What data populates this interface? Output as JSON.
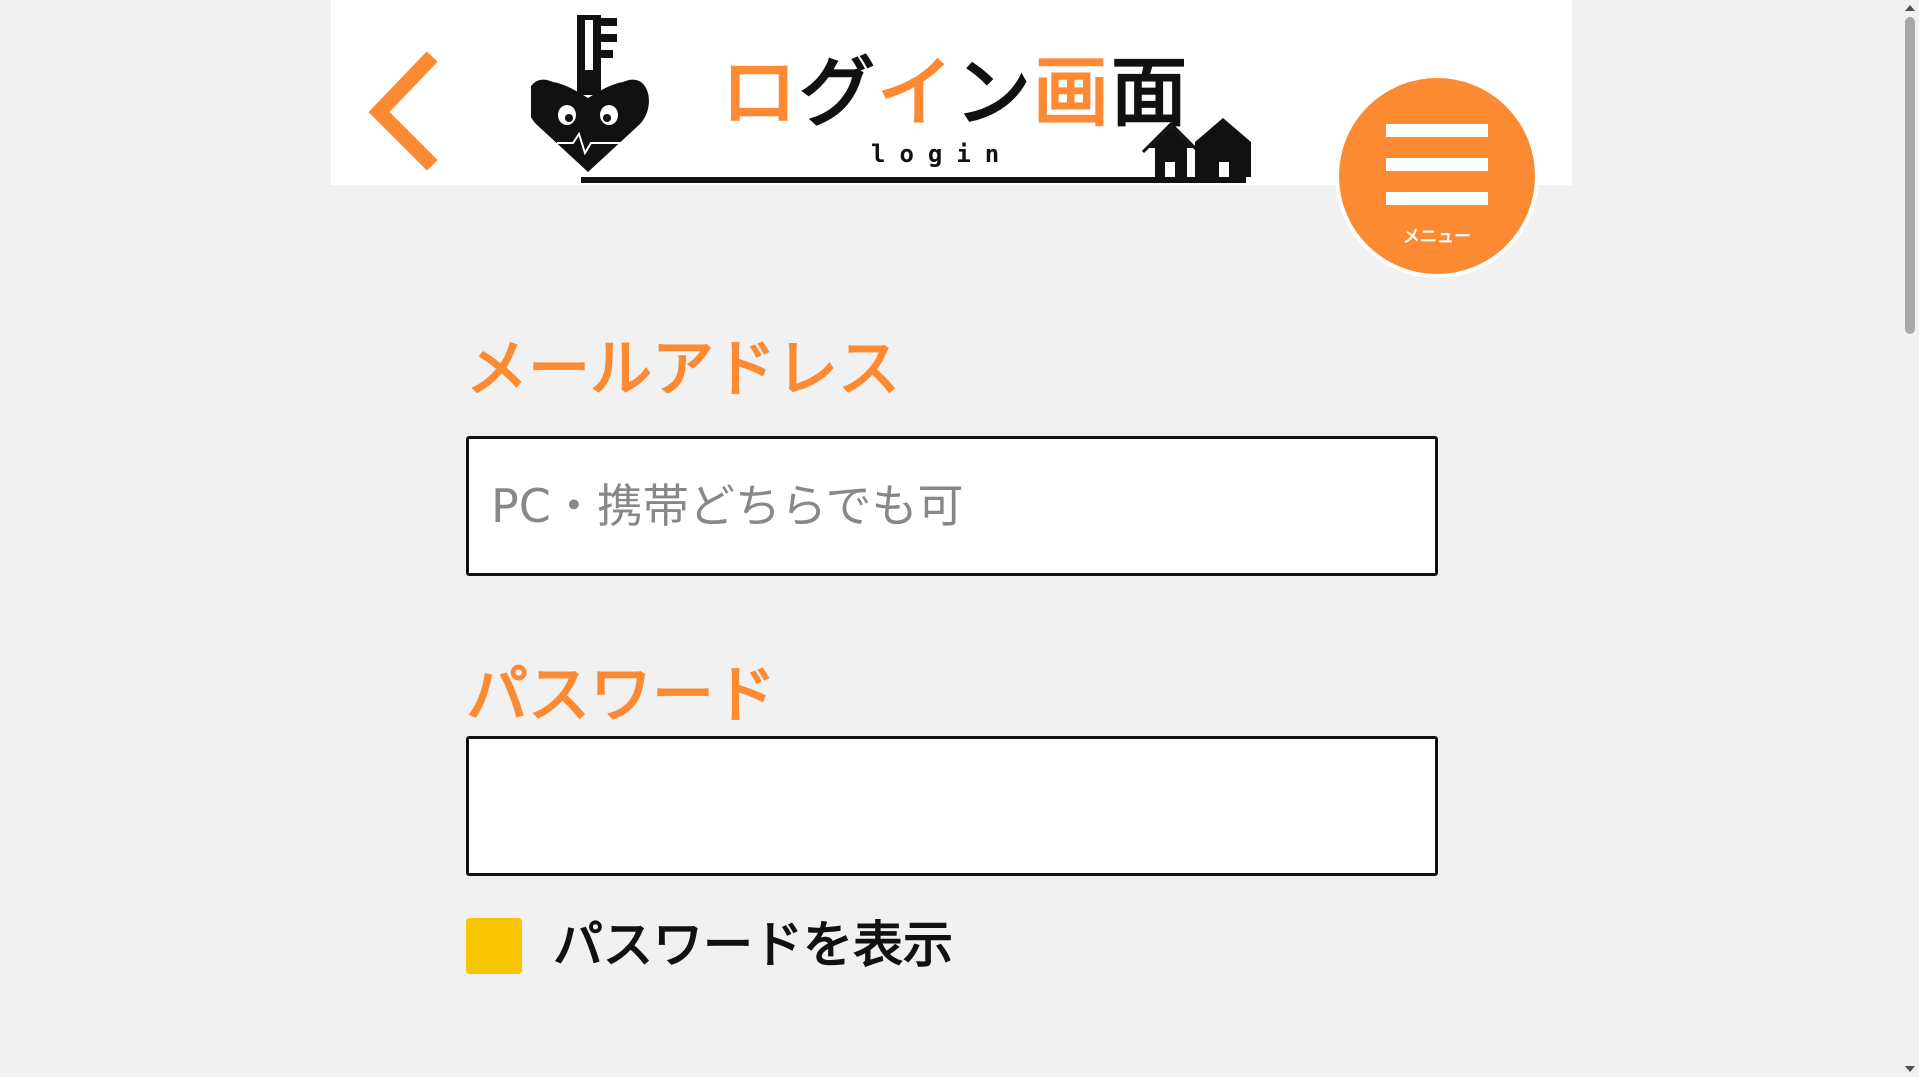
{
  "header": {
    "logo": {
      "title_orange_1": "ロ",
      "title_black_1": "グ",
      "title_orange_2": "イ",
      "title_black_2": "ン",
      "title_orange_3": "画",
      "title_black_3": "面",
      "subtitle": "login"
    },
    "menu_label": "メニュー"
  },
  "form": {
    "email_label": "メールアドレス",
    "email_placeholder": "PC・携帯どちらでも可",
    "email_value": "",
    "password_label": "パスワード",
    "password_value": "",
    "show_password_label": "パスワードを表示",
    "show_password_checked": false
  },
  "colors": {
    "accent": "#fb8a33",
    "checkbox": "#f7c600",
    "background": "#f1f1f1"
  },
  "icons": [
    "back-chevron-icon",
    "key-heart-logo-icon",
    "house-icon",
    "hamburger-menu-icon"
  ]
}
